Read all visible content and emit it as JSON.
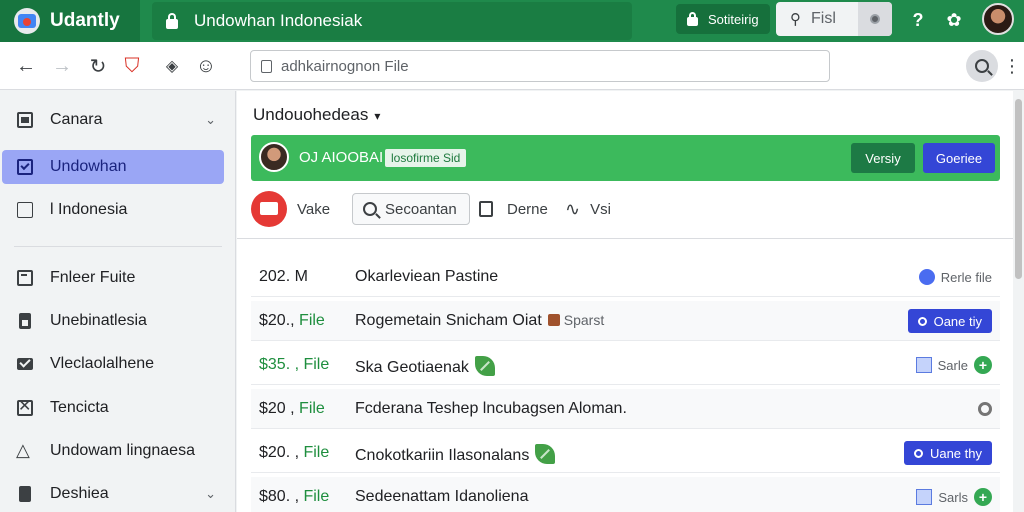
{
  "topbar": {
    "brand": "Udantly",
    "tab_title": "Undowhan Indonesiak",
    "settings_label": "Sotiteirig",
    "find_label": "Fisl"
  },
  "toolbar": {
    "address_placeholder": "adhkairnognon File"
  },
  "sidebar": {
    "items": [
      {
        "label": "Canara",
        "icon": "calendar-icon"
      },
      {
        "label": "Undowhan",
        "icon": "inbox-icon"
      },
      {
        "label": "l Indonesia",
        "icon": "square-icon"
      },
      {
        "label": "Fnleer Fuite",
        "icon": "folder-icon"
      },
      {
        "label": "Unebinatlesia",
        "icon": "bookmark-icon"
      },
      {
        "label": "Vleclaolalhene",
        "icon": "mail-icon"
      },
      {
        "label": "Tencicta",
        "icon": "close-box-icon"
      },
      {
        "label": "Undowam lingnaesa",
        "icon": "drive-icon"
      },
      {
        "label": "Deshiea",
        "icon": "label-icon"
      }
    ]
  },
  "main": {
    "folder_title": "Undouohedeas",
    "banner": {
      "name": "OJ AIOOBAI",
      "chip": "losofirme Sid",
      "btn_secondary": "Versiy",
      "btn_primary": "Goeriee"
    },
    "actions": {
      "make": "Vake",
      "search": "Secoantan",
      "bookmark": "Derne",
      "link": "Vsi"
    },
    "rows": [
      {
        "amount": "202. M",
        "amount_suffix": "",
        "desc": "Okarleviean Pastine",
        "tag": "",
        "right": "Rerle file"
      },
      {
        "amount": "$20.,",
        "amount_suffix": " File",
        "desc": "Rogemetain Snicham Oiat",
        "tag": "Sparst",
        "right": "Oane tiy"
      },
      {
        "amount": "$35. ,",
        "amount_suffix": " File",
        "desc": "Ska Geotiaenak",
        "tag": "",
        "right": "Sarle"
      },
      {
        "amount": "$20 ,",
        "amount_suffix": " File",
        "desc": "Fcderana Teshep lncubagsen Aloman.",
        "tag": "",
        "right": ""
      },
      {
        "amount": "$20. ,",
        "amount_suffix": " File",
        "desc": "Cnokotkariin Ilasonalans",
        "tag": "",
        "right": "Uane thy"
      },
      {
        "amount": "$80. ,",
        "amount_suffix": " File",
        "desc": "Sedeenattam Idanoliena",
        "tag": "",
        "right": "Sarls"
      }
    ]
  }
}
